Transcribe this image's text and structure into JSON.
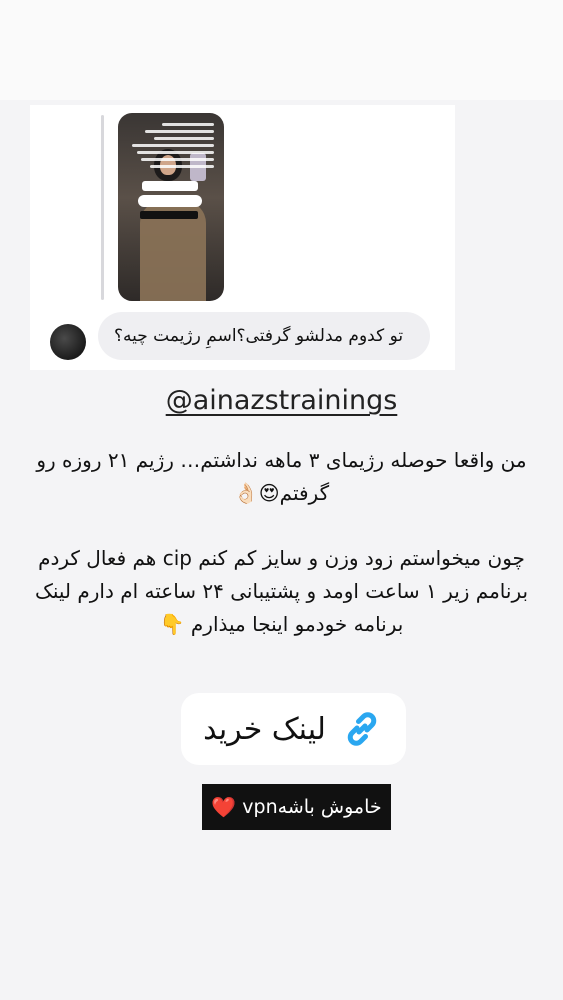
{
  "reply": {
    "comment_text": "تو کدوم مدلشو گرفتی؟اسمِ رژیمت چیه؟"
  },
  "story": {
    "handle": "@ainazstrainings",
    "paragraph1": "من واقعا حوصله رژیمای ۳ ماهه نداشتم… رژیم ۲۱ روزه رو گرفتم😍👌🏻",
    "paragraph2": "چون میخواستم زود وزن و سایز کم کنم cip هم فعال کردم برنامم زیر ۱ ساعت اومد و پشتیبانی ۲۴ ساعته ام دارم لینک برنامه خودمو اینجا میذارم 👇",
    "link_label": "لینک خرید",
    "vpn_label": "vpnخاموش باشه",
    "vpn_heart": "❤️"
  },
  "icons": {
    "link": "link-icon",
    "heart": "heart-icon"
  },
  "colors": {
    "link_icon": "#2aa7f0",
    "heart": "#e0102a"
  }
}
